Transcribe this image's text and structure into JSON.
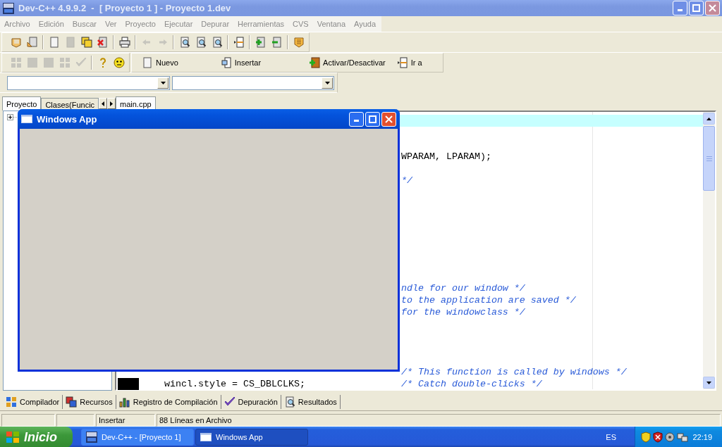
{
  "window": {
    "title": "Dev-C++ 4.9.9.2  -  [ Proyecto 1 ] - Proyecto 1.dev",
    "active": false
  },
  "menu": [
    "Archivo",
    "Edición",
    "Buscar",
    "Ver",
    "Proyecto",
    "Ejecutar",
    "Depurar",
    "Herramientas",
    "CVS",
    "Ventana",
    "Ayuda"
  ],
  "toolbar_main": [
    [
      {
        "kind": "project-open",
        "disabled": false
      },
      {
        "kind": "project-history",
        "disabled": false
      }
    ],
    [
      {
        "kind": "page",
        "disabled": false
      },
      {
        "kind": "save",
        "disabled": true
      },
      {
        "kind": "save-all",
        "disabled": false
      },
      {
        "kind": "close-page",
        "disabled": false
      }
    ],
    [
      {
        "kind": "printer",
        "disabled": false
      }
    ],
    [
      {
        "kind": "undo",
        "disabled": true
      },
      {
        "kind": "redo",
        "disabled": true
      }
    ],
    [
      {
        "kind": "find",
        "disabled": false
      },
      {
        "kind": "find-next",
        "disabled": false
      },
      {
        "kind": "replace",
        "disabled": false
      }
    ],
    [
      {
        "kind": "goto",
        "disabled": false
      }
    ],
    [
      {
        "kind": "add-page",
        "disabled": false
      },
      {
        "kind": "remove-page",
        "disabled": false
      }
    ],
    [
      {
        "kind": "options",
        "disabled": false
      }
    ]
  ],
  "toolbar_compile": [
    [
      {
        "kind": "grid",
        "disabled": true
      },
      {
        "kind": "square",
        "disabled": true
      },
      {
        "kind": "square",
        "disabled": true
      },
      {
        "kind": "grid",
        "disabled": true
      },
      {
        "kind": "check",
        "disabled": true
      }
    ],
    [
      {
        "kind": "help",
        "disabled": false
      },
      {
        "kind": "smiley",
        "disabled": false
      }
    ]
  ],
  "toolbar_class": [
    {
      "label": "Nuevo",
      "kind": "page"
    },
    {
      "label": "Insertar",
      "kind": "insert"
    },
    {
      "label": "Activar/Desactivar",
      "kind": "toggle"
    },
    {
      "label": "Ir a",
      "kind": "goto"
    }
  ],
  "left_tabs": [
    {
      "label": "Proyecto",
      "selected": true
    },
    {
      "label": "Clases(Funcic",
      "selected": false
    }
  ],
  "project_tree": {
    "expanded": false
  },
  "editor_tabs": [
    {
      "label": "main.cpp",
      "selected": true
    }
  ],
  "editor_lines": [
    {
      "kind": "current"
    },
    {
      "kind": "blank"
    },
    {
      "kind": "blank"
    },
    {
      "kind": "text",
      "tail": {
        "text": "WPARAM, LPARAM);",
        "kind": "code"
      }
    },
    {
      "kind": "blank"
    },
    {
      "kind": "text",
      "tail": {
        "text": "*/",
        "kind": "comment"
      }
    },
    {
      "kind": "blank"
    },
    {
      "kind": "blank"
    },
    {
      "kind": "blank"
    },
    {
      "kind": "blank"
    },
    {
      "kind": "blank"
    },
    {
      "kind": "blank"
    },
    {
      "kind": "blank"
    },
    {
      "kind": "blank"
    },
    {
      "kind": "text",
      "tail": {
        "text": "ndle for our window */",
        "kind": "comment"
      }
    },
    {
      "kind": "text",
      "tail": {
        "text": "to the application are saved */",
        "kind": "comment"
      }
    },
    {
      "kind": "text",
      "tail": {
        "text": "for the windowclass */",
        "kind": "comment"
      }
    },
    {
      "kind": "blank"
    },
    {
      "kind": "blank"
    },
    {
      "kind": "blank"
    },
    {
      "kind": "blank"
    },
    {
      "kind": "text",
      "marker": false,
      "tail": {
        "text": "/* This function is called by windows */",
        "kind": "comment"
      }
    },
    {
      "kind": "text",
      "marker": true,
      "code": "    wincl.style = CS_DBLCLKS;",
      "tail": {
        "text": "/* Catch double-clicks */",
        "kind": "comment"
      }
    }
  ],
  "bottom_tabs": [
    {
      "label": "Compilador",
      "kind": "grid"
    },
    {
      "label": "Recursos",
      "kind": "resources"
    },
    {
      "label": "Registro de Compilación",
      "kind": "chart"
    },
    {
      "label": "Depuración",
      "kind": "check"
    },
    {
      "label": "Resultados",
      "kind": "find"
    }
  ],
  "status_bar": [
    "Insertar",
    "88 Líneas en Archivo"
  ],
  "app_window": {
    "title": "Windows App",
    "active": true
  },
  "taskbar": {
    "start": "Inicio",
    "items": [
      {
        "label": "Dev-C++ - [Proyecto 1]",
        "kind": "devcpp",
        "selected": false
      },
      {
        "label": "Windows App",
        "kind": "window",
        "selected": true
      }
    ],
    "language": "ES",
    "clock": "22:19"
  }
}
